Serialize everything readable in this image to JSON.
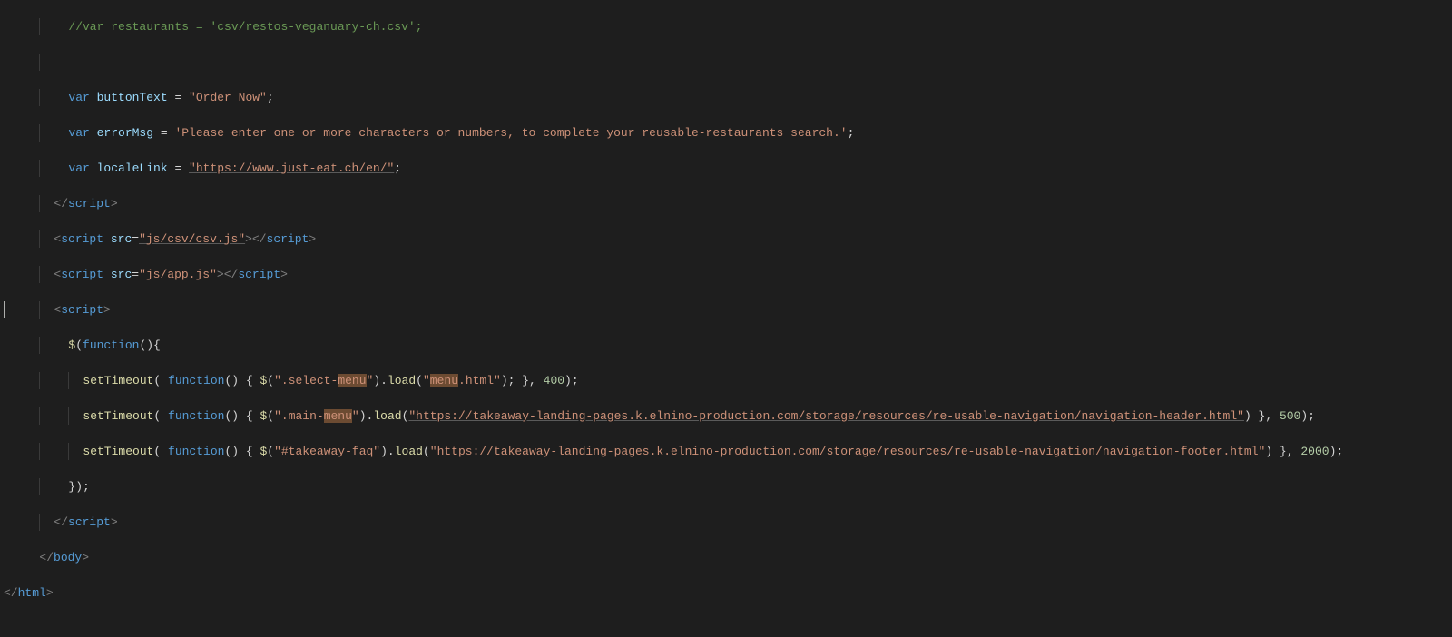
{
  "code": {
    "comment_restaurants": "//var restaurants = 'csv/restos-veganuary-ch.csv';",
    "var_kw": "var",
    "buttonText_name": "buttonText",
    "buttonText_val": "\"Order Now\"",
    "errorMsg_name": "errorMsg",
    "errorMsg_val": "'Please enter one or more characters or numbers, to complete your reusable-restaurants search.'",
    "localeLink_name": "localeLink",
    "localeLink_val": "\"https://www.just-eat.ch/en/\"",
    "tag_script": "script",
    "attr_src": "src",
    "src_csv": "\"js/csv/csv.js\"",
    "src_app": "\"js/app.js\"",
    "jq_open": "$(",
    "fn_kw": "function",
    "jq_close": "(){",
    "setTimeout": "setTimeout",
    "sel_selectmenu_a": "\".select-",
    "sel_selectmenu_hl": "menu",
    "sel_selectmenu_b": "\"",
    "load": "load",
    "menuhtml_a": "\"",
    "menuhtml_hl": "menu",
    "menuhtml_b": ".html\"",
    "delay1": "400",
    "sel_mainmenu_a": "\".main-",
    "sel_mainmenu_hl": "menu",
    "sel_mainmenu_b": "\"",
    "url_header": "\"https://takeaway-landing-pages.k.elnino-production.com/storage/resources/re-usable-navigation/navigation-header.html\"",
    "delay2": "500",
    "sel_faq": "\"#takeaway-faq\"",
    "url_footer": "\"https://takeaway-landing-pages.k.elnino-production.com/storage/resources/re-usable-navigation/navigation-footer.html\"",
    "delay3": "2000",
    "close_fn": "});",
    "tag_body": "body",
    "tag_html": "html",
    "eq": " = ",
    "semi": ";",
    "lt": "<",
    "gt": ">",
    "lts": "</",
    "op": "(",
    "cp": ")",
    "ob": "{",
    "cb": "}",
    "cm": ",",
    "sp": " ",
    "dollar": "$",
    "dot": "."
  }
}
